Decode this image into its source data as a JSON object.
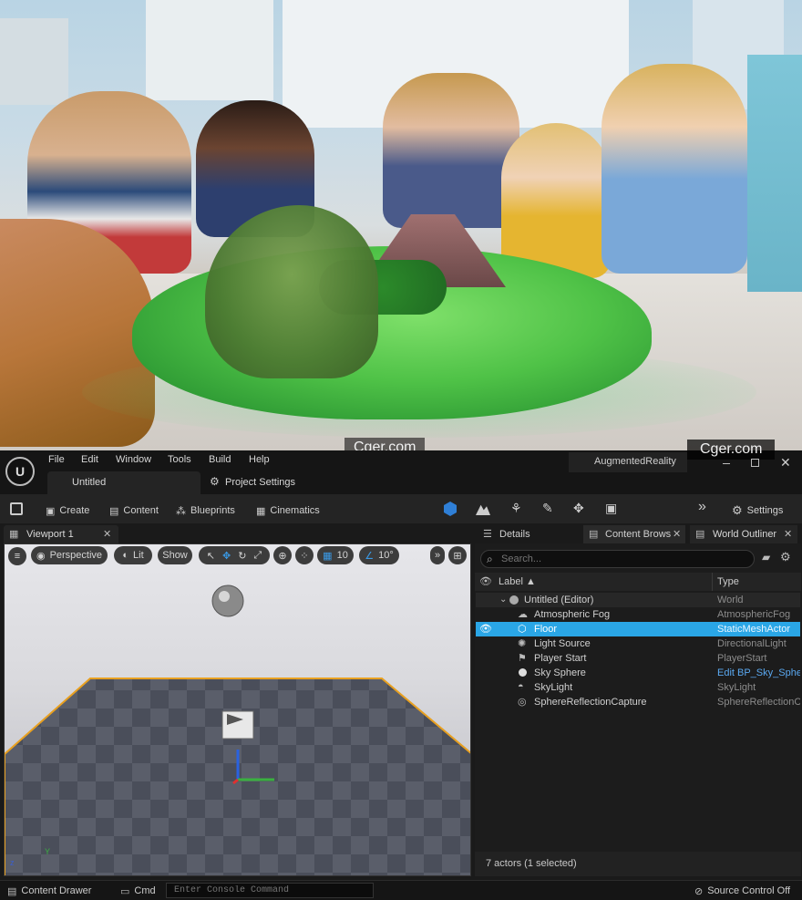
{
  "watermarks": [
    "Cger.com",
    "Cger.com"
  ],
  "menu": [
    "File",
    "Edit",
    "Window",
    "Tools",
    "Build",
    "Help"
  ],
  "project_name": "AugmentedReality",
  "doc_tab": "Untitled",
  "project_settings_tab": "Project Settings",
  "toolbar": {
    "create": "Create",
    "content": "Content",
    "blueprints": "Blueprints",
    "cinematics": "Cinematics",
    "settings": "Settings"
  },
  "viewport": {
    "tab_label": "Viewport 1",
    "perspective": "Perspective",
    "lit": "Lit",
    "show": "Show",
    "grid_snap": "10",
    "angle_snap": "10°"
  },
  "panels": {
    "details": "Details",
    "content_browser": "Content Brows",
    "world_outliner": "World Outliner"
  },
  "outliner": {
    "search_placeholder": "Search...",
    "col_label": "Label ▲",
    "col_type": "Type",
    "root_label": "Untitled (Editor)",
    "root_type": "World",
    "items": [
      {
        "label": "Atmospheric Fog",
        "type": "AtmosphericFog",
        "icon": "fog-icon"
      },
      {
        "label": "Floor",
        "type": "StaticMeshActor",
        "icon": "cube-icon",
        "selected": true
      },
      {
        "label": "Light Source",
        "type": "DirectionalLight",
        "icon": "sun-icon"
      },
      {
        "label": "Player Start",
        "type": "PlayerStart",
        "icon": "flag-icon"
      },
      {
        "label": "Sky Sphere",
        "type": "Edit BP_Sky_Sphere",
        "icon": "sphere-icon"
      },
      {
        "label": "SkyLight",
        "type": "SkyLight",
        "icon": "skylight-icon"
      },
      {
        "label": "SphereReflectionCapture",
        "type": "SphereReflectionCapture",
        "icon": "capture-icon"
      }
    ],
    "status": "7 actors (1 selected)"
  },
  "statusbar": {
    "content_drawer": "Content Drawer",
    "cmd": "Cmd",
    "console_placeholder": "Enter Console Command",
    "source_control": "Source Control Off"
  },
  "colors": {
    "selection": "#2aa6e6",
    "accent_blue": "#2f7fd6",
    "floor_outline": "#e8a020"
  }
}
